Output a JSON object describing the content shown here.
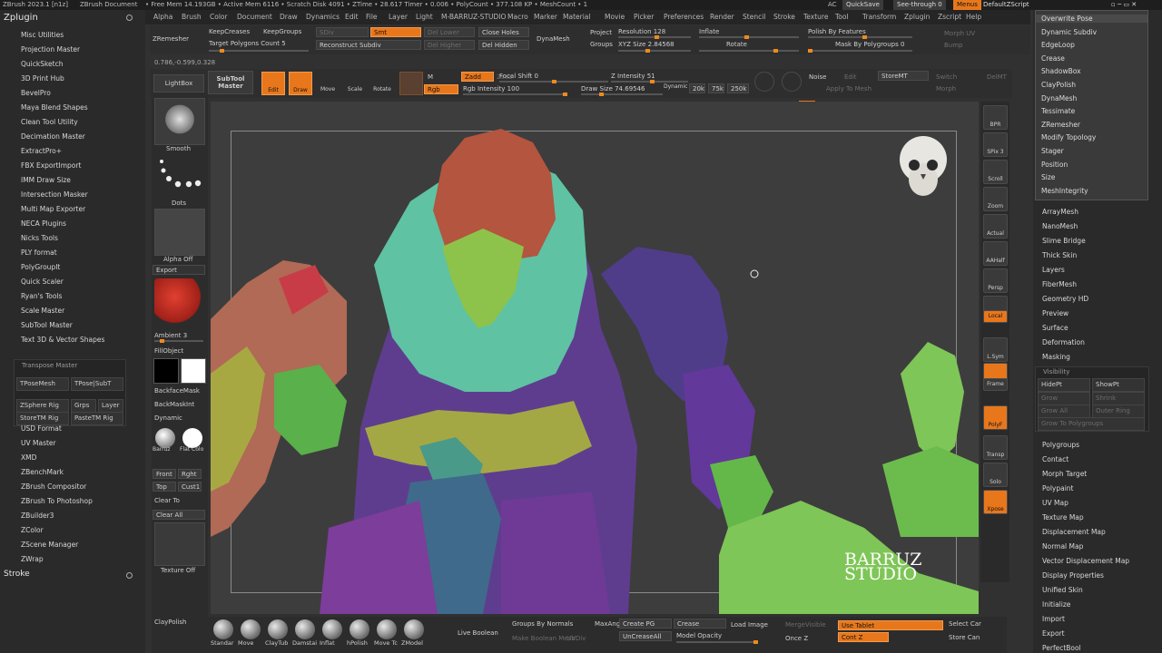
{
  "titlebar": {
    "app": "ZBrush 2023.1 [n1z]",
    "doc": "ZBrush Document",
    "stats": "• Free Mem 14.193GB • Active Mem 6116 • Scratch Disk 4091 • ZTime • 28.617 Timer • 0.006 • PolyCount • 377.108 KP • MeshCount • 1",
    "ac": "AC",
    "quicksave": "QuickSave",
    "seethrough": "See-through 0",
    "menus": "Menus",
    "script": "DefaultZScript"
  },
  "left_panel": {
    "title": "Zplugin",
    "items": [
      "Misc Utilities",
      "Projection Master",
      "QuickSketch",
      "3D Print Hub",
      "BevelPro",
      "Maya Blend Shapes",
      "Clean Tool Utility",
      "Decimation Master",
      "ExtractPro+",
      "FBX ExportImport",
      "IMM Draw Size",
      "Intersection Masker",
      "Multi Map Exporter",
      "NECA Plugins",
      "Nicks Tools",
      "PLY format",
      "PolyGroupIt",
      "Quick Scaler",
      "Ryan's Tools",
      "Scale Master",
      "SubTool Master",
      "Text 3D & Vector Shapes"
    ],
    "transpose": {
      "title": "Transpose Master",
      "buttons": [
        "TPoseMesh",
        "TPose|SubT",
        "ZSphere Rig",
        "Grps",
        "Layer",
        "StoreTM Rig",
        "PasteTM Rig"
      ]
    },
    "items2": [
      "USD Format",
      "UV Master",
      "XMD",
      "ZBenchMark",
      "ZBrush Compositor",
      "ZBrush To Photoshop",
      "ZBuilder3",
      "ZColor",
      "ZScene Manager",
      "ZWrap"
    ],
    "stroke": "Stroke"
  },
  "menubar": [
    "Alpha",
    "Brush",
    "Color",
    "Document",
    "Draw",
    "Dynamics",
    "Edit",
    "File",
    "Layer",
    "Light",
    "M-BARRUZ-STUDIO",
    "Macro",
    "Marker",
    "Material",
    "Movie",
    "Picker",
    "Preferences",
    "Render",
    "Stencil",
    "Stroke",
    "Texture",
    "Tool",
    "Transform",
    "Zplugin",
    "Zscript",
    "Help"
  ],
  "toolbar1": {
    "zremesher": "ZRemesher",
    "keepcreases": "KeepCreases",
    "keepgroups": "KeepGroups",
    "sdiv": "SDiv",
    "smt": "Smt",
    "del_lower": "Del Lower",
    "del_higher": "Del Higher",
    "close_holes": "Close Holes",
    "del_hidden": "Del Hidden",
    "target": "Target Polygons Count 5",
    "reconstruct": "Reconstruct Subdiv",
    "dynamesh": "DynaMesh",
    "project": "Project",
    "groups": "Groups",
    "resolution": "Resolution 128",
    "xyz_size": "XYZ Size 2.84568",
    "inflate": "Inflate",
    "rotate": "Rotate",
    "polish_features": "Polish By Features",
    "mask_polygroups": "Mask By Polygroups 0",
    "morph_uv": "Morph UV",
    "bump": "Bump",
    "coords": "0.786,-0.599,0.328"
  },
  "toolbar2": {
    "lightbox": "LightBox",
    "subtool_master": "SubTool Master",
    "edit": "Edit",
    "draw": "Draw",
    "move": "Move",
    "scale": "Scale",
    "rotate": "Rotate",
    "m": "M",
    "rgb": "Rgb",
    "zadd": "Zadd",
    "zsub": "Zsub",
    "focal_shift": "Focal Shift 0",
    "rgb_intensity": "Rgb Intensity 100",
    "z_intensity": "Z Intensity 51",
    "draw_size": "Draw Size 74.69546",
    "dynamic": "Dynamic",
    "k20": "20k",
    "k75": "75k",
    "k250": "250k",
    "noise": "Noise",
    "edit2": "Edit",
    "storemt": "StoreMT",
    "switch": "Switch",
    "delmt": "DelMT",
    "apply_mesh": "Apply To Mesh",
    "morph": "Morph"
  },
  "toolcol": {
    "smooth": "Smooth",
    "dots": "Dots",
    "alpha_off": "Alpha Off",
    "export": "Export",
    "ambient": "Ambient 3",
    "fillobject": "FillObject",
    "backfacemask": "BackfaceMask",
    "backmaskint": "BackMaskInt",
    "dynamic": "Dynamic",
    "barruz": "Barruz",
    "flat_color": "Flat Colo",
    "front": "Front",
    "right": "Rght",
    "top": "Top",
    "cust1": "Cust1",
    "clear_to": "Clear To",
    "clear_all": "Clear All",
    "texture_off": "Texture Off",
    "claypolish": "ClayPolish"
  },
  "iconcol": [
    "BPR",
    "SPix 3",
    "Scroll",
    "Zoom",
    "Actual",
    "AAHalf",
    "Persp",
    "Floor",
    "Local",
    "L.Sym",
    "XYZ",
    "Frame",
    "PolyF",
    "Transp",
    "Solo",
    "Xpose"
  ],
  "dropdown": [
    "Overwrite Pose",
    "Dynamic Subdiv",
    "EdgeLoop",
    "Crease",
    "ShadowBox",
    "ClayPolish",
    "DynaMesh",
    "Tessimate",
    "ZRemesher",
    "Modify Topology",
    "Stager",
    "Position",
    "Size",
    "MeshIntegrity"
  ],
  "right_panel": {
    "items_a": [
      "ArrayMesh",
      "NanoMesh",
      "Slime Bridge",
      "Thick Skin",
      "Layers",
      "FiberMesh",
      "Geometry HD",
      "Preview",
      "Surface",
      "Deformation",
      "Masking"
    ],
    "visibility": {
      "title": "Visibility",
      "buttons": [
        "HidePt",
        "ShowPt",
        "Grow",
        "Shrink",
        "Grow All",
        "Outer Ring",
        "Grow To Polygroups"
      ]
    },
    "items_b": [
      "Polygroups",
      "Contact",
      "Morph Target",
      "Polypaint",
      "UV Map",
      "Texture Map",
      "Displacement Map",
      "Normal Map",
      "Vector Displacement Map",
      "Display Properties",
      "Unified Skin",
      "Initialize",
      "Import",
      "Export",
      "PerfectBool"
    ]
  },
  "bottom": {
    "brushes": [
      "Standar",
      "Move",
      "ClayTub",
      "Damstai",
      "Inflat",
      "hPolish",
      "Move Tc",
      "ZModel"
    ],
    "live_boolean": "Live Boolean",
    "groups_normals": "Groups By Normals",
    "max_angle": "MaxAng",
    "make_boolean": "Make Boolean Mesh",
    "create_pg": "Create PG",
    "uncrease_all": "UnCreaseAll",
    "crease": "Crease",
    "model_opacity": "Model Opacity",
    "load_image": "Load Image",
    "merge_visible": "MergeVisible",
    "once_z": "Once Z",
    "use_tablet": "Use Tablet",
    "cont_z": "Cont Z",
    "select_cam": "Select Car",
    "store_cam": "Store Can",
    "uv_disp": "UVDiv"
  },
  "watermark": [
    "BARRUZ",
    "STUDIO"
  ],
  "colors": {
    "accent": "#e8771c",
    "panel": "#2a2a2a",
    "viewport": "#3d3d3d"
  }
}
